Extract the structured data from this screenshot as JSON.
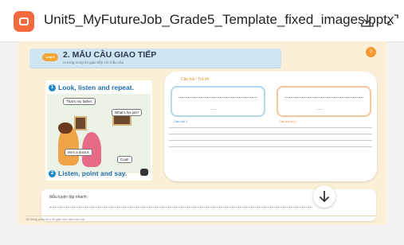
{
  "window": {
    "title": "Unit5_MyFutureJob_Grade5_Template_fixed_images.pptx",
    "app_icon": "presentation-icon",
    "accent": "#f26a3d",
    "download_icon": "download-icon",
    "expand_icon": "expand-icon"
  },
  "slide": {
    "badge": "Lớp 5",
    "badge_number": "3",
    "section_title": "2. MẪU CÂU GIAO TIẾP",
    "section_subtitle": "Hướng trong lời giao tiếp với mẫu câu",
    "book": {
      "step1_number": "1",
      "step1_label": "Look, listen and repeat.",
      "step2_number": "2",
      "step2_label": "Listen, point and say.",
      "bubble1": "That's my father.",
      "bubble2": "What's his job?",
      "bubble3": "He's a doctor.",
      "bubble4": "Cool!"
    },
    "qa": {
      "header": "Câu hỏi / Trả lời",
      "card1_dots": "......",
      "card2_dots": "......",
      "caption_left": "Câu hỏi 1",
      "caption_right": "Câu trả lời 1"
    },
    "practice_label": "Mẫu luyện tập nhanh:",
    "footer": "Bố thông phần và ly dễ giảm sẽm điện theo lớp."
  }
}
